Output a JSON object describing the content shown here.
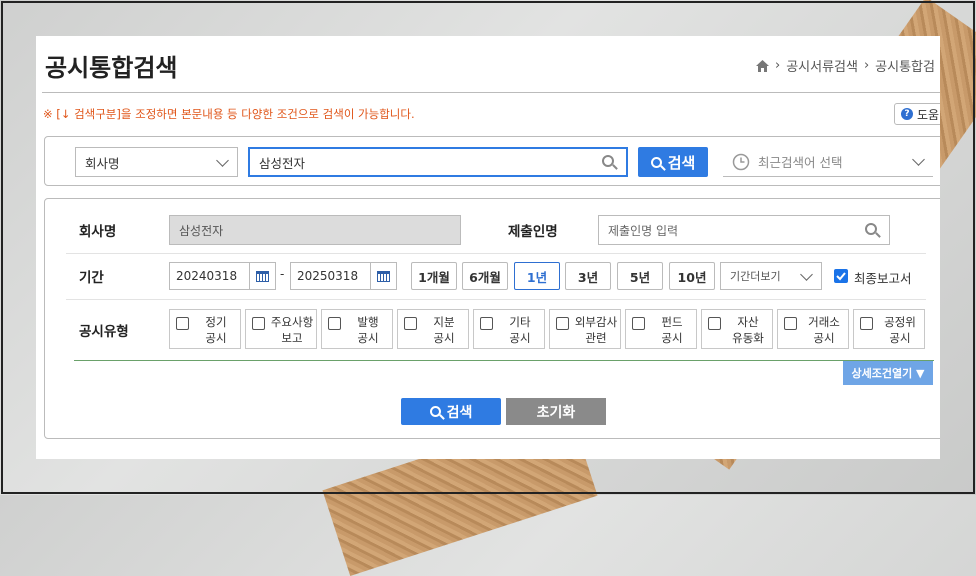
{
  "header": {
    "title": "공시통합검색",
    "breadcrumb": [
      "공시서류검색",
      "공시통합검"
    ],
    "help_label": "도움"
  },
  "notice": "※ [↓ 검색구분]을 조정하면 본문내용 등 다양한 조건으로 검색이 가능합니다.",
  "search_bar": {
    "type_select": "회사명",
    "query": "삼성전자",
    "search_button": "검색",
    "recent_placeholder": "최근검색어 선택"
  },
  "filters": {
    "company_label": "회사명",
    "company_value": "삼성전자",
    "submitter_label": "제출인명",
    "submitter_placeholder": "제출인명 입력",
    "period_label": "기간",
    "date_from": "20240318",
    "date_sep": "-",
    "date_to": "20250318",
    "periods": [
      "1개월",
      "6개월",
      "1년",
      "3년",
      "5년",
      "10년"
    ],
    "period_more": "기간더보기",
    "final_report_label": "최종보고서",
    "type_label": "공시유형",
    "types": [
      {
        "l1": "정기",
        "l2": "공시"
      },
      {
        "l1": "주요사항",
        "l2": "보고"
      },
      {
        "l1": "발행",
        "l2": "공시"
      },
      {
        "l1": "지분",
        "l2": "공시"
      },
      {
        "l1": "기타",
        "l2": "공시"
      },
      {
        "l1": "외부감사",
        "l2": "관련"
      },
      {
        "l1": "펀드",
        "l2": "공시"
      },
      {
        "l1": "자산",
        "l2": "유동화"
      },
      {
        "l1": "거래소",
        "l2": "공시"
      },
      {
        "l1": "공정위",
        "l2": "공시"
      }
    ],
    "detail_toggle": "상세조건열기 ▼"
  },
  "actions": {
    "search": "검색",
    "reset": "초기화"
  },
  "colors": {
    "accent": "#2f7be2",
    "notice": "#e0561a",
    "reset": "#8a8a8a"
  }
}
